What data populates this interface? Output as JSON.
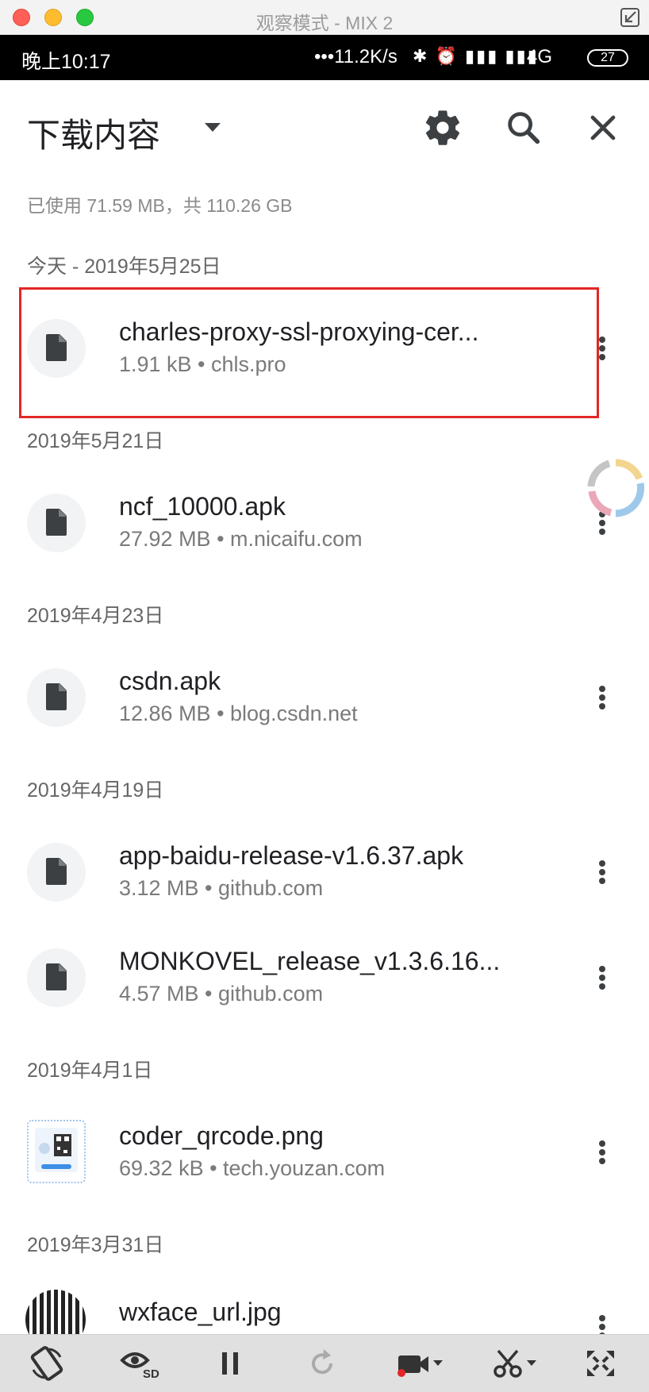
{
  "window": {
    "title": "观察模式 - MIX 2"
  },
  "status_bar": {
    "time": "晚上10:17",
    "net_speed": "•••11.2K/s",
    "network": "4G",
    "battery": "27"
  },
  "header": {
    "title": "下载内容"
  },
  "storage_summary": "已使用 71.59 MB，共 110.26 GB",
  "groups": [
    {
      "date": "今天 - 2019年5月25日",
      "items": [
        {
          "name": "charles-proxy-ssl-proxying-cer...",
          "meta": "1.91 kB • chls.pro",
          "icon": "file-icon"
        }
      ]
    },
    {
      "date": "2019年5月21日",
      "items": [
        {
          "name": "ncf_10000.apk",
          "meta": "27.92 MB • m.nicaifu.com",
          "icon": "file-icon"
        }
      ]
    },
    {
      "date": "2019年4月23日",
      "items": [
        {
          "name": "csdn.apk",
          "meta": "12.86 MB • blog.csdn.net",
          "icon": "file-icon"
        }
      ]
    },
    {
      "date": "2019年4月19日",
      "items": [
        {
          "name": "app-baidu-release-v1.6.37.apk",
          "meta": "3.12 MB • github.com",
          "icon": "file-icon"
        },
        {
          "name": "MONKOVEL_release_v1.3.6.16...",
          "meta": "4.57 MB • github.com",
          "icon": "file-icon"
        }
      ]
    },
    {
      "date": "2019年4月1日",
      "items": [
        {
          "name": "coder_qrcode.png",
          "meta": "69.32 kB • tech.youzan.com",
          "icon": "image-thumbnail"
        }
      ]
    },
    {
      "date": "2019年3月31日",
      "items": [
        {
          "name": "wxface_url.jpg",
          "meta": "",
          "icon": "image-thumbnail"
        }
      ]
    }
  ],
  "toolbar_icons": [
    "rotate-icon",
    "view-sd-icon",
    "pause-icon",
    "refresh-icon",
    "record-icon",
    "screenshot-icon",
    "fullscreen-icon"
  ],
  "colors": {
    "highlight": "#e32626",
    "accent": "#202124"
  }
}
